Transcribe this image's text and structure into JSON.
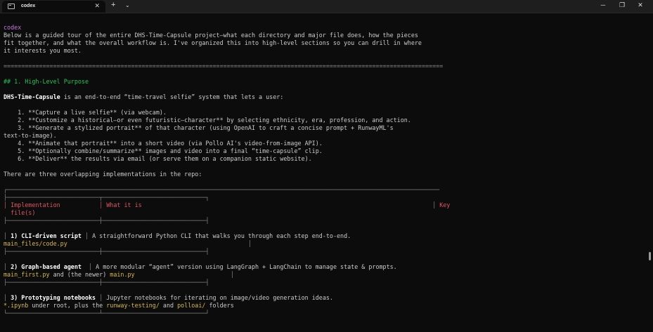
{
  "window": {
    "tab_title": "codex",
    "tab_close": "✕",
    "new_tab": "+",
    "dropdown": "⌄",
    "minimize": "─",
    "maximize": "❐",
    "close": "✕"
  },
  "terminal": {
    "speaker": "codex",
    "intro1": "Below is a guided tour of the entire DHS-Time-Capsule project—what each directory and major file does, how the pieces",
    "intro2": "fit together, and what the overall workflow is. I've organized this into high-level sections so you can drill in where",
    "intro3": "it interests you most.",
    "divider": "============================================================================================================================",
    "heading1": "## 1. High-Level Purpose",
    "purpose_name": "DHS-Time-Capsule",
    "purpose_rest": " is an end-to-end “time-travel selfie” system that lets a user:",
    "step1": "    1. **Capture a live selfie** (via webcam).",
    "step2": "    2. **Customize a historical—or even futuristic—character** by selecting ethnicity, era, profession, and action.",
    "step3a": "    3. **Generate a stylized portrait** of that character (using OpenAI to craft a concise prompt + RunwayML's",
    "step3b": "text-to-image).",
    "step4": "    4. **Animate that portrait** into a short video (via Pollo AI's video-from-image API).",
    "step5": "    5. **Optionally combine/summarize** images and video into a final “time-capsule” clip.",
    "step6": "    6. **Deliver** the results via email (or serve them on a companion static website).",
    "impl_intro": "There are three overlapping implementations in the repo:",
    "table": {
      "top_rule": "┌──────────────────────────────────────────────────────────────────────────────────────────────────────────────────────────",
      "hdr_sep": "├──────────────────────────┬─────────────────────────────┐",
      "hdr_col1": "│ Implementation           │",
      "hdr_col2": " What it is",
      "hdr_pad": "                                                                                  │",
      "hdr_col3": " Key",
      "hdr_col4": "  file(s)",
      "row_sep": "├──────────────────────────┼─────────────────────────────┤",
      "bar": "│",
      "row1_label": " 1) CLI-driven script ",
      "row1_desc": " A straightforward Python CLI that walks you through each step end-to-end.",
      "row1_file": "main_files/code.py",
      "row1_file_pad": "                                                   │",
      "row2_label": " 2) Graph-based agent  ",
      "row2_desc": " A more modular “agent” version using LangGraph + LangChain to manage state & prompts.",
      "row2_file_a": "main_first.py",
      "row2_file_mid": " and (the newer) ",
      "row2_file_b": "main.py",
      "row2_file_pad": "                           │",
      "row3_label": " 3) Prototyping notebooks ",
      "row3_desc": " Jupyter notebooks for iterating on image/video generation ideas.",
      "row3_file_a": "*.ipynb",
      "row3_file_mid": " under root, plus the ",
      "row3_file_b": "runway-testing/",
      "row3_file_mid2": " and ",
      "row3_file_c": "polloai/",
      "row3_file_end": " folders",
      "bottom_rule": "└──────────────────────────┴─────────────────────────────┘"
    }
  }
}
